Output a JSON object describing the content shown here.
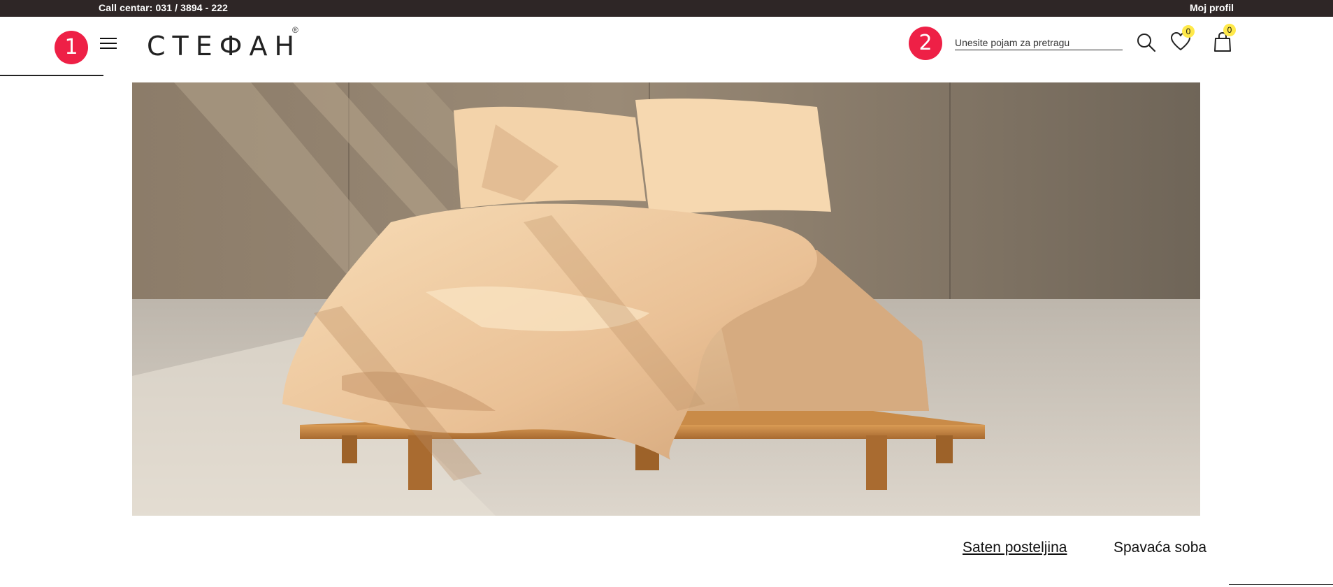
{
  "topbar": {
    "call_center": "Call centar: 031 / 3894 - 222",
    "profile_label": "Moj profil"
  },
  "markers": [
    "1",
    "2"
  ],
  "header": {
    "logo_text": "СТЕФАН",
    "logo_registered": "®",
    "search_placeholder": "Unesite pojam za pretragu",
    "wishlist_count": "0",
    "cart_count": "0",
    "icons": [
      "menu-icon",
      "search-icon",
      "heart-icon",
      "shopping-bag-icon"
    ]
  },
  "hero": {
    "image": "bed-with-peach-satin-bedding"
  },
  "links": {
    "satin": "Saten posteljina",
    "bedroom": "Spavaća soba"
  },
  "colors": {
    "topbar": "#2e2626",
    "marker": "#ee2046",
    "badge": "#ffe94a"
  }
}
